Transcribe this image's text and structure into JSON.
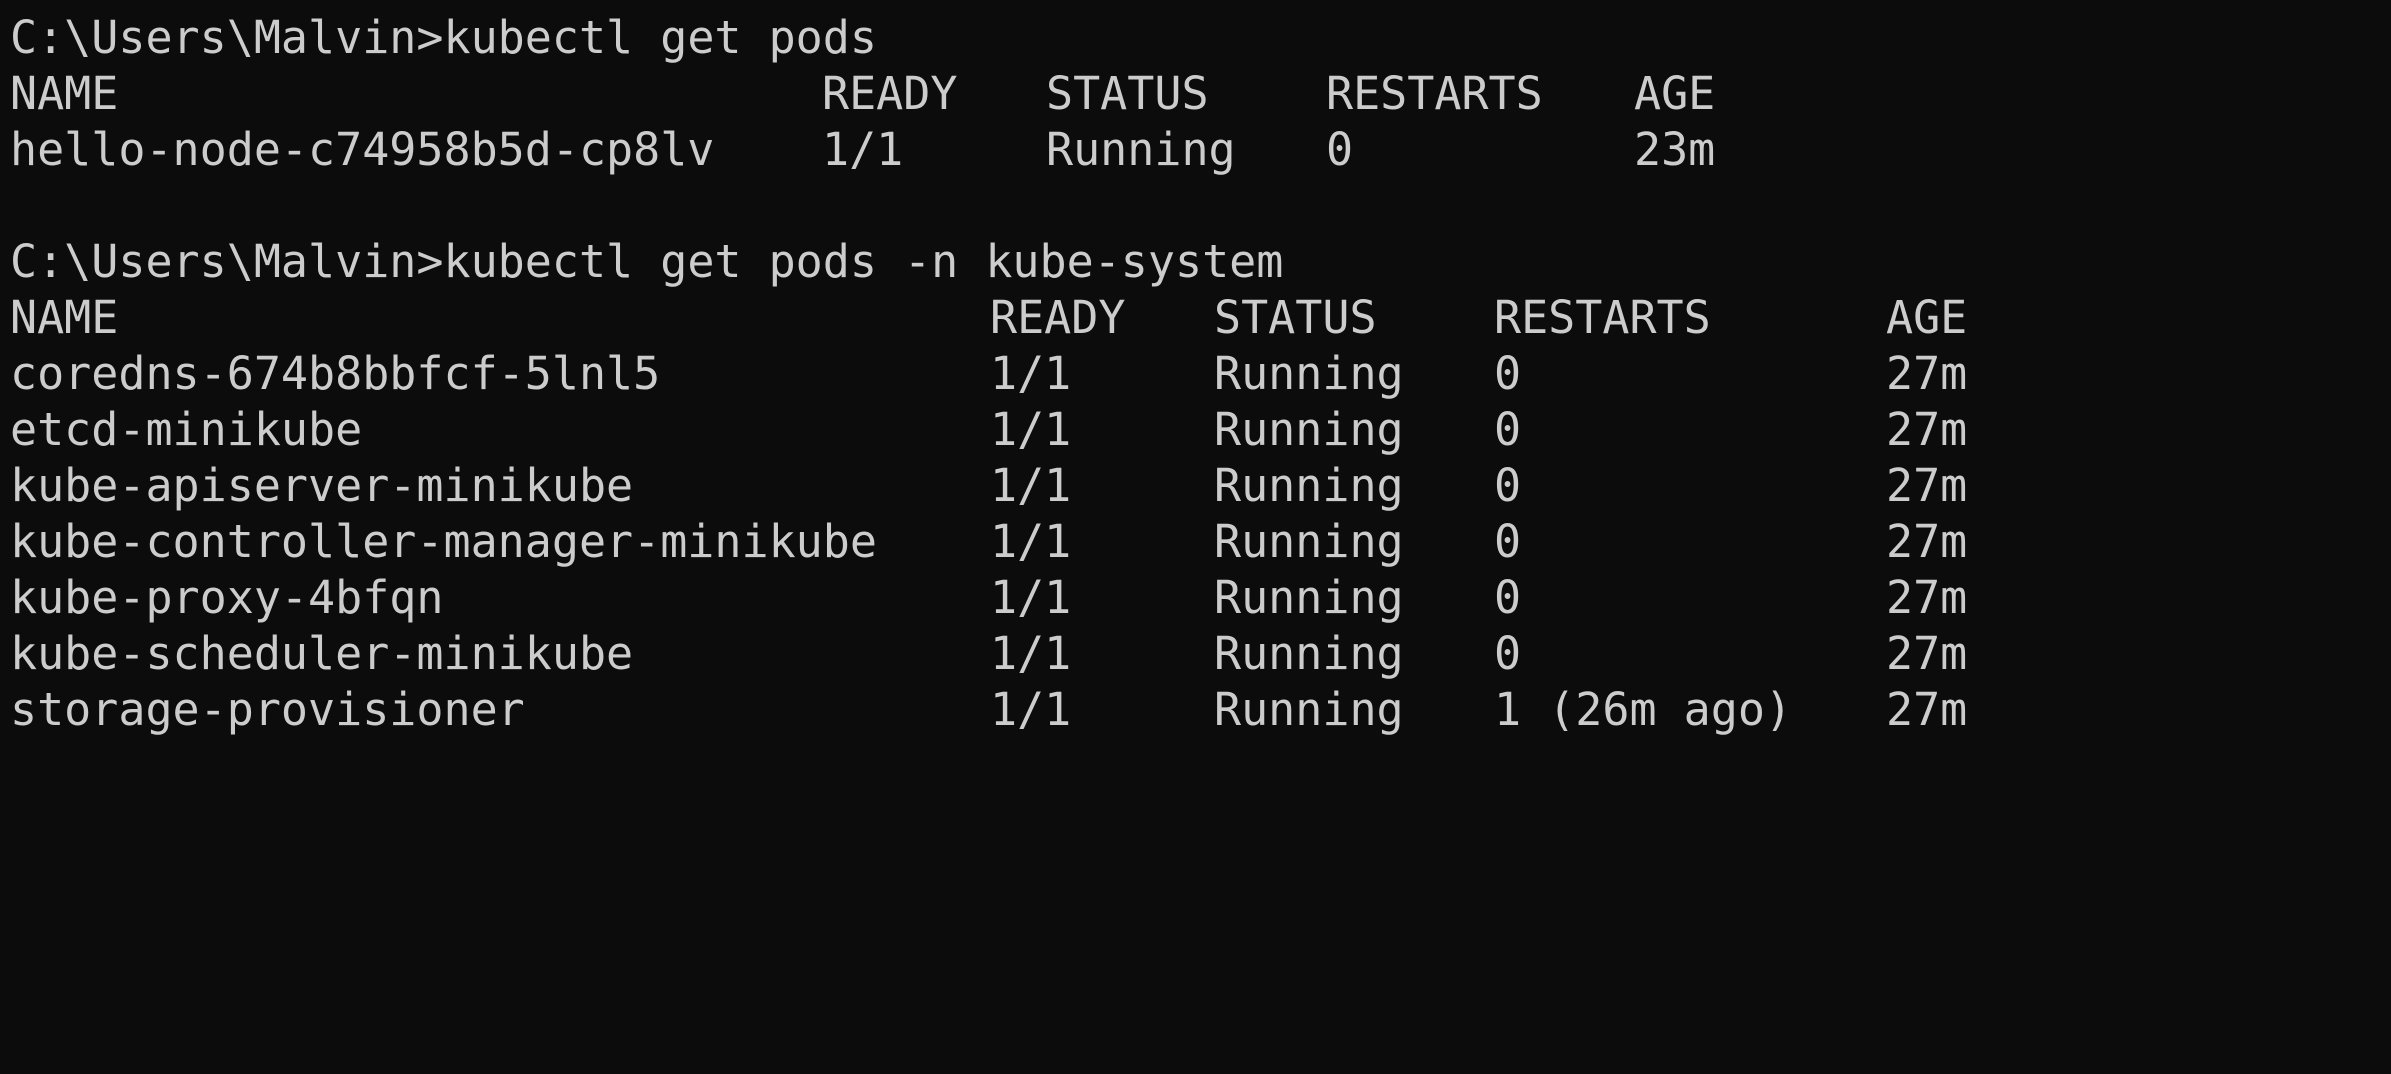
{
  "session": [
    {
      "prompt": "C:\\Users\\Malvin>",
      "command": "kubectl get pods",
      "headers": [
        "NAME",
        "READY",
        "STATUS",
        "RESTARTS",
        "AGE"
      ],
      "rows": [
        [
          "hello-node-c74958b5d-cp8lv",
          "1/1",
          "Running",
          "0",
          "23m"
        ]
      ]
    },
    {
      "prompt": "C:\\Users\\Malvin>",
      "command": "kubectl get pods -n kube-system",
      "headers": [
        "NAME",
        "READY",
        "STATUS",
        "RESTARTS",
        "AGE"
      ],
      "rows": [
        [
          "coredns-674b8bbfcf-5lnl5",
          "1/1",
          "Running",
          "0",
          "27m"
        ],
        [
          "etcd-minikube",
          "1/1",
          "Running",
          "0",
          "27m"
        ],
        [
          "kube-apiserver-minikube",
          "1/1",
          "Running",
          "0",
          "27m"
        ],
        [
          "kube-controller-manager-minikube",
          "1/1",
          "Running",
          "0",
          "27m"
        ],
        [
          "kube-proxy-4bfqn",
          "1/1",
          "Running",
          "0",
          "27m"
        ],
        [
          "kube-scheduler-minikube",
          "1/1",
          "Running",
          "0",
          "27m"
        ],
        [
          "storage-provisioner",
          "1/1",
          "Running",
          "1 (26m ago)",
          "27m"
        ]
      ]
    }
  ],
  "colors": {
    "background": "#0c0c0c",
    "text": "#cccccc"
  }
}
